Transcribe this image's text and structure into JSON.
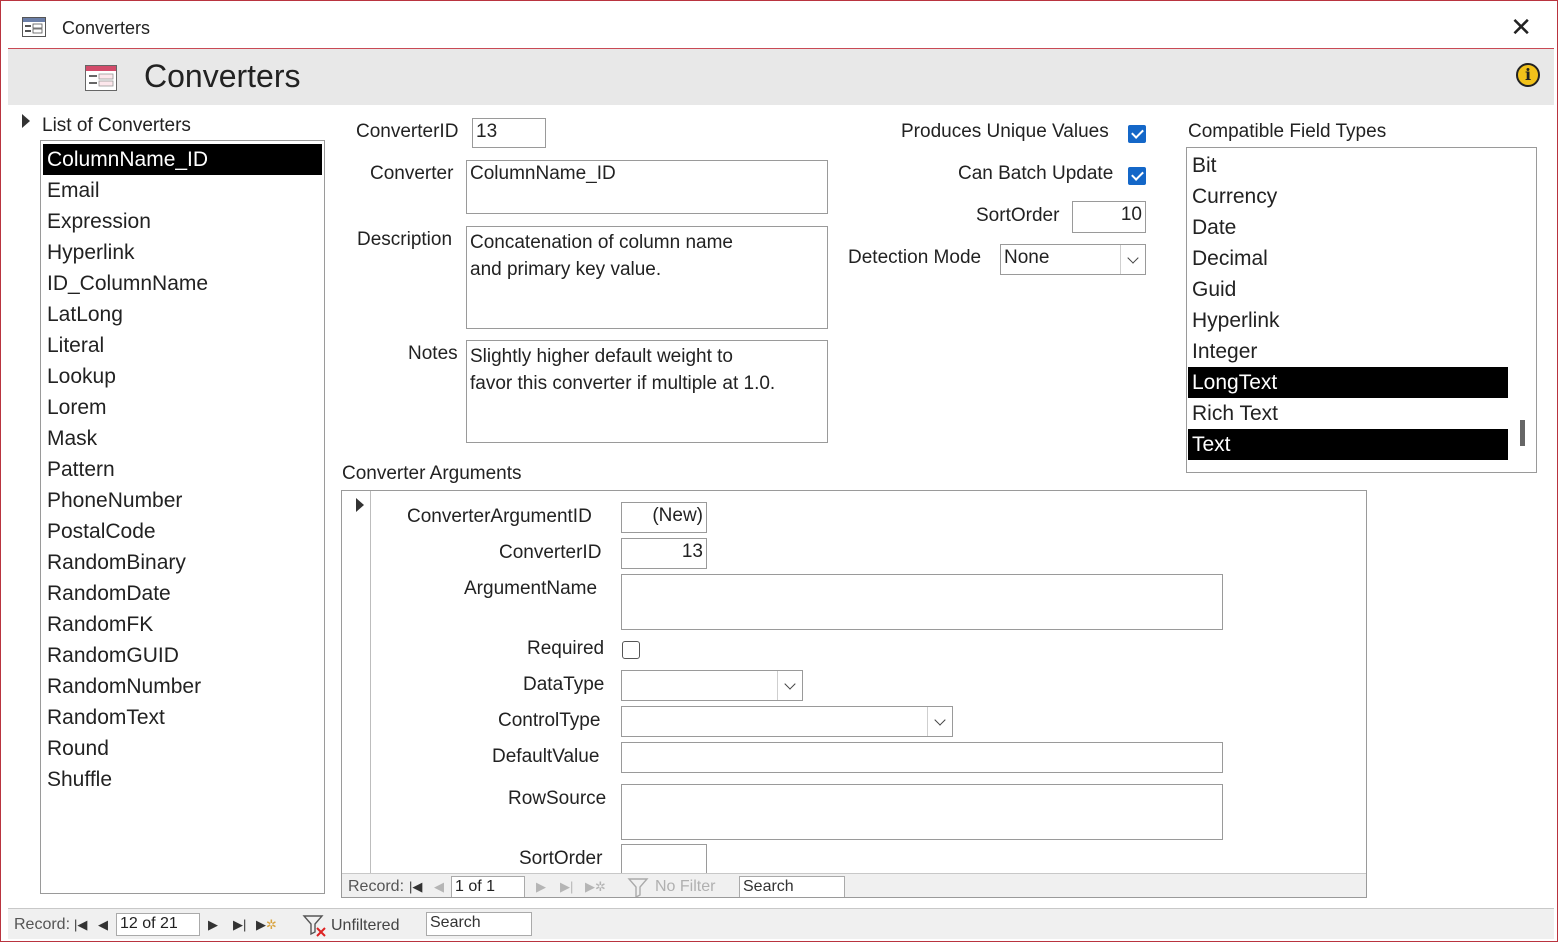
{
  "window": {
    "title": "Converters",
    "close_label": "✕"
  },
  "header": {
    "title": "Converters"
  },
  "converter_list": {
    "label": "List of Converters",
    "selected_index": 0,
    "items": [
      "ColumnName_ID",
      "Email",
      "Expression",
      "Hyperlink",
      "ID_ColumnName",
      "LatLong",
      "Literal",
      "Lookup",
      "Lorem",
      "Mask",
      "Pattern",
      "PhoneNumber",
      "PostalCode",
      "RandomBinary",
      "RandomDate",
      "RandomFK",
      "RandomGUID",
      "RandomNumber",
      "RandomText",
      "Round",
      "Shuffle"
    ]
  },
  "form": {
    "converter_id_label": "ConverterID",
    "converter_id_value": "13",
    "converter_label": "Converter",
    "converter_value": "ColumnName_ID",
    "description_label": "Description",
    "description_value": "Concatenation of column name and primary key value.",
    "notes_label": "Notes",
    "notes_value": "Slightly higher default weight to favor this converter if multiple at 1.0.",
    "produces_unique_label": "Produces Unique Values",
    "produces_unique_checked": true,
    "can_batch_label": "Can Batch Update",
    "can_batch_checked": true,
    "sort_order_label": "SortOrder",
    "sort_order_value": "10",
    "detection_mode_label": "Detection Mode",
    "detection_mode_value": "None"
  },
  "field_types": {
    "label": "Compatible Field Types",
    "items": [
      {
        "name": "Bit",
        "selected": false
      },
      {
        "name": "Currency",
        "selected": false
      },
      {
        "name": "Date",
        "selected": false
      },
      {
        "name": "Decimal",
        "selected": false
      },
      {
        "name": "Guid",
        "selected": false
      },
      {
        "name": "Hyperlink",
        "selected": false
      },
      {
        "name": "Integer",
        "selected": false
      },
      {
        "name": "LongText",
        "selected": true
      },
      {
        "name": "Rich Text",
        "selected": false
      },
      {
        "name": "Text",
        "selected": true
      }
    ]
  },
  "arguments": {
    "section_label": "Converter Arguments",
    "argument_id_label": "ConverterArgumentID",
    "argument_id_value": "(New)",
    "converter_id_label": "ConverterID",
    "converter_id_value": "13",
    "argument_name_label": "ArgumentName",
    "argument_name_value": "",
    "required_label": "Required",
    "required_checked": false,
    "data_type_label": "DataType",
    "data_type_value": "",
    "control_type_label": "ControlType",
    "control_type_value": "",
    "default_value_label": "DefaultValue",
    "default_value_value": "",
    "row_source_label": "RowSource",
    "row_source_value": "",
    "sort_order_label": "SortOrder",
    "sort_order_value": ""
  },
  "sub_nav": {
    "record_label": "Record:",
    "position": "1 of 1",
    "filter_label": "No Filter",
    "search_placeholder": "Search"
  },
  "main_nav": {
    "record_label": "Record:",
    "position": "12 of 21",
    "filter_label": "Unfiltered",
    "search_placeholder": "Search"
  }
}
